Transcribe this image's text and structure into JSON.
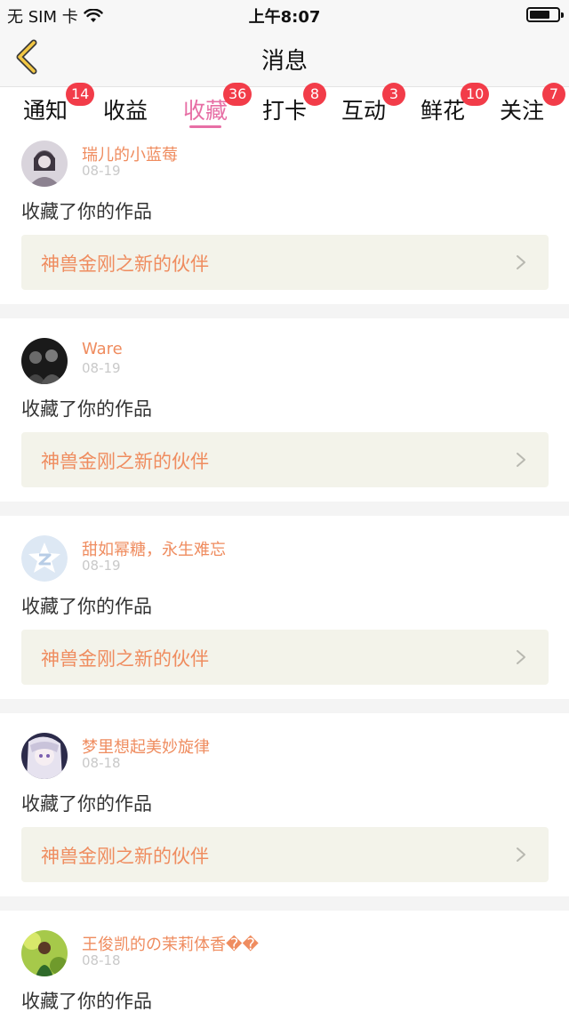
{
  "status_bar": {
    "carrier": "无 SIM 卡",
    "time": "上午8:07"
  },
  "nav": {
    "title": "消息"
  },
  "tabs": [
    {
      "label": "通知",
      "badge": "14"
    },
    {
      "label": "收益",
      "badge": ""
    },
    {
      "label": "收藏",
      "badge": "36",
      "active": true
    },
    {
      "label": "打卡",
      "badge": "8"
    },
    {
      "label": "互动",
      "badge": "3"
    },
    {
      "label": "鲜花",
      "badge": "10"
    },
    {
      "label": "关注",
      "badge": "7"
    }
  ],
  "colors": {
    "accent": "#e76fa5",
    "name_orange": "#ef8c5f",
    "badge_red": "#f23c49",
    "work_bg": "#f3f3ea"
  },
  "messages": [
    {
      "user": "瑞儿的小蓝莓",
      "date": "08-19",
      "action": "收藏了你的作品",
      "work": "神兽金刚之新的伙伴"
    },
    {
      "user": "Ware",
      "date": "08-19",
      "action": "收藏了你的作品",
      "work": "神兽金刚之新的伙伴"
    },
    {
      "user": "甜如幂糖，永生难忘",
      "date": "08-19",
      "action": "收藏了你的作品",
      "work": "神兽金刚之新的伙伴"
    },
    {
      "user": "梦里想起美妙旋律",
      "date": "08-18",
      "action": "收藏了你的作品",
      "work": "神兽金刚之新的伙伴"
    },
    {
      "user": "王俊凯的の茉莉体香��",
      "date": "08-18",
      "action": "收藏了你的作品",
      "work": ""
    }
  ]
}
